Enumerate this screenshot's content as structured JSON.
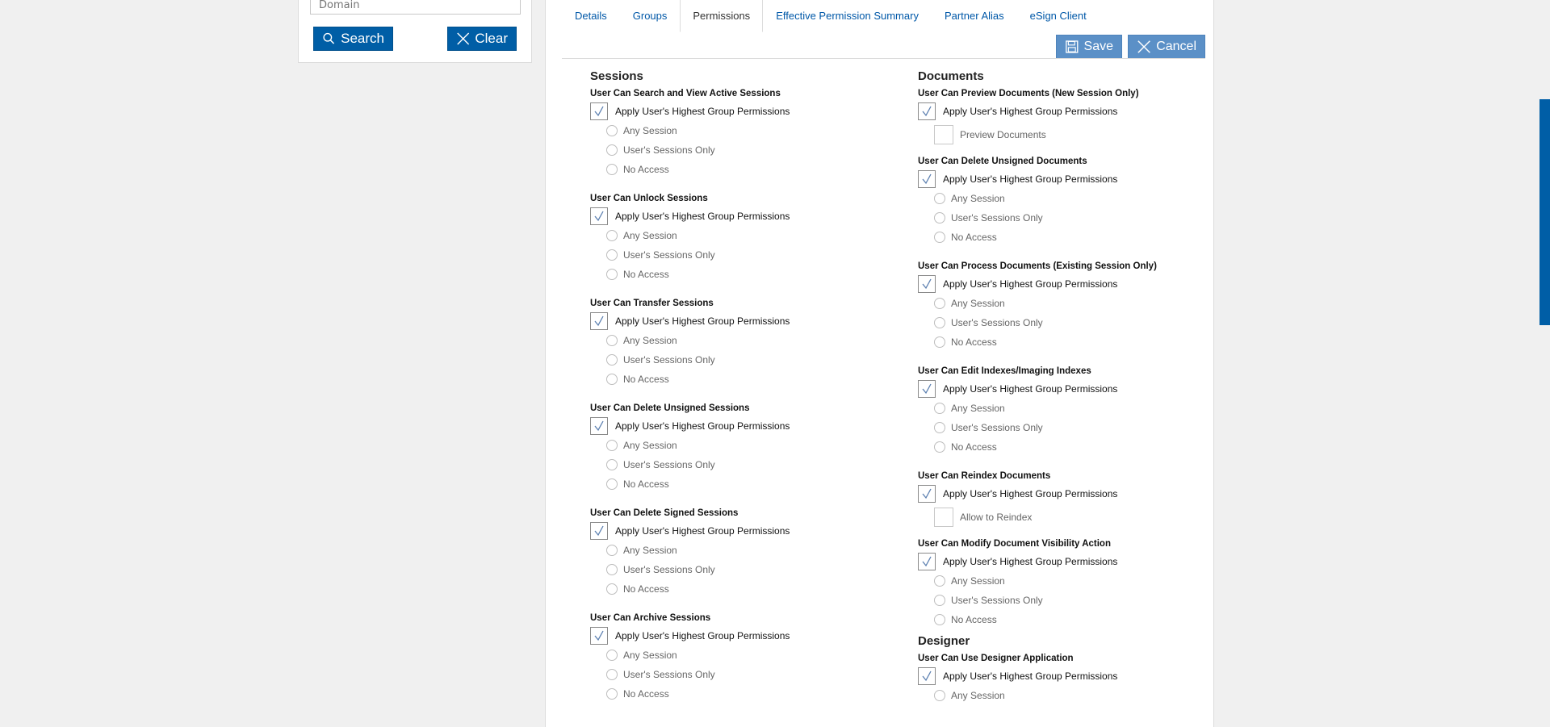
{
  "left_panel": {
    "domain_placeholder": "Domain",
    "search_label": "Search",
    "clear_label": "Clear"
  },
  "tabs": [
    {
      "label": "Details"
    },
    {
      "label": "Groups"
    },
    {
      "label": "Permissions"
    },
    {
      "label": "Effective Permission Summary"
    },
    {
      "label": "Partner Alias"
    },
    {
      "label": "eSign Client"
    }
  ],
  "actions": {
    "save_label": "Save",
    "cancel_label": "Cancel"
  },
  "apply_label": "Apply User's Highest Group Permissions",
  "options": {
    "any": "Any Session",
    "users": "User's Sessions Only",
    "none": "No Access"
  },
  "sessions": {
    "title": "Sessions",
    "groups": [
      "User Can Search and View Active Sessions",
      "User Can Unlock Sessions",
      "User Can Transfer Sessions",
      "User Can Delete Unsigned Sessions",
      "User Can Delete Signed Sessions",
      "User Can Archive Sessions"
    ]
  },
  "documents": {
    "title": "Documents",
    "preview_title": "User Can Preview Documents (New Session Only)",
    "preview_option": "Preview Documents",
    "delete_unsigned_title": "User Can Delete Unsigned Documents",
    "process_title": "User Can Process Documents (Existing Session Only)",
    "edit_indexes_title": "User Can Edit Indexes/Imaging Indexes",
    "reindex_title": "User Can Reindex Documents",
    "reindex_option": "Allow to Reindex",
    "visibility_title": "User Can Modify Document Visibility Action"
  },
  "designer": {
    "title": "Designer",
    "use_title": "User Can Use Designer Application"
  },
  "colors": {
    "primary": "#005ea6",
    "action": "#5b90c7",
    "link": "#0058a8"
  }
}
